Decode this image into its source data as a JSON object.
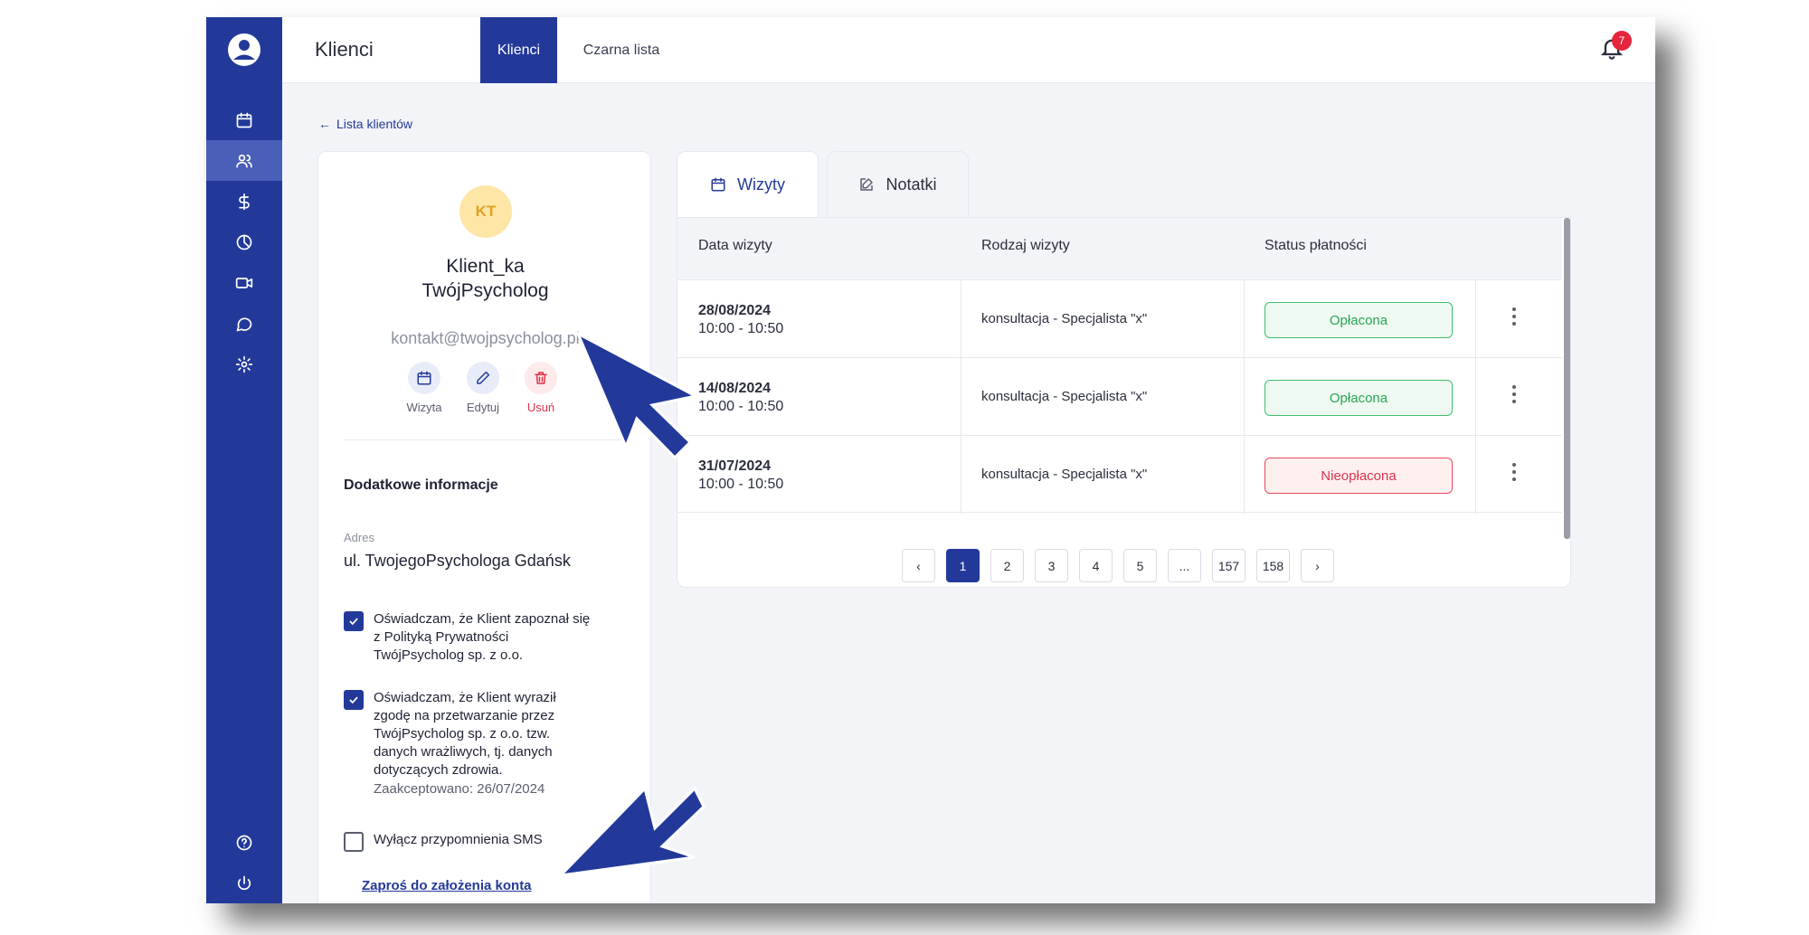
{
  "colors": {
    "primary": "#23399a",
    "sidebar_active": "#4a5fb8",
    "paid": "#2aa457",
    "unpaid": "#d9334a",
    "badge": "#e5253b",
    "avatar_bg": "#fde6a6"
  },
  "sidebar": {
    "items": [
      {
        "icon": "calendar-icon"
      },
      {
        "icon": "users-icon",
        "active": true
      },
      {
        "icon": "dollar-icon"
      },
      {
        "icon": "chart-pie-icon"
      },
      {
        "icon": "video-icon"
      },
      {
        "icon": "chat-icon"
      },
      {
        "icon": "gear-icon"
      }
    ],
    "bottom": [
      {
        "icon": "help-icon"
      },
      {
        "icon": "power-icon"
      }
    ]
  },
  "header": {
    "title": "Klienci",
    "tabs": [
      {
        "label": "Klienci",
        "active": true
      },
      {
        "label": "Czarna lista",
        "active": false
      }
    ],
    "notifications_count": "7"
  },
  "back_link": "Lista klientów",
  "client": {
    "initials": "KT",
    "name": "Klient_ka\nTwójPsycholog",
    "email": "kontakt@twojpsycholog.pl",
    "actions": [
      {
        "label": "Wizyta",
        "icon": "calendar-icon"
      },
      {
        "label": "Edytuj",
        "icon": "pencil-icon"
      },
      {
        "label": "Usuń",
        "icon": "trash-icon"
      }
    ],
    "section_title": "Dodatkowe informacje",
    "address_label": "Adres",
    "address_value": "ul. TwojegoPsychologa Gdańsk",
    "consents": [
      {
        "text": "Oświadczam, że Klient zapoznał się\nz Polityką Prywatności\nTwójPsycholog sp. z o.o.",
        "checked": true
      },
      {
        "text": "Oświadczam, że Klient wyraził\nzgodę na przetwarzanie przez\nTwójPsycholog sp. z o.o. tzw.\ndanych wrażliwych, tj. danych\ndotyczących zdrowia.",
        "checked": true,
        "sub": "Zaakceptowano: 26/07/2024"
      },
      {
        "text": "Wyłącz przypomnienia SMS",
        "checked": false
      }
    ],
    "invite_link": "Zaproś do założenia konta"
  },
  "visits": {
    "tabs": [
      {
        "label": "Wizyty",
        "icon": "calendar-icon",
        "active": true
      },
      {
        "label": "Notatki",
        "icon": "edit-icon",
        "active": false
      }
    ],
    "columns": [
      "Data wizyty",
      "Rodzaj wizyty",
      "Status płatności"
    ],
    "rows": [
      {
        "date": "28/08/2024",
        "time": "10:00 - 10:50",
        "kind": "konsultacja - Specjalista \"x\"",
        "status": "Opłacona",
        "paid": true
      },
      {
        "date": "14/08/2024",
        "time": "10:00 - 10:50",
        "kind": "konsultacja - Specjalista \"x\"",
        "status": "Opłacona",
        "paid": true
      },
      {
        "date": "31/07/2024",
        "time": "10:00 - 10:50",
        "kind": "konsultacja - Specjalista \"x\"",
        "status": "Nieopłacona",
        "paid": false
      }
    ],
    "pagination": {
      "prev": "‹",
      "pages": [
        "1",
        "2",
        "3",
        "4",
        "5",
        "...",
        "157",
        "158"
      ],
      "current": "1",
      "next": "›"
    }
  }
}
